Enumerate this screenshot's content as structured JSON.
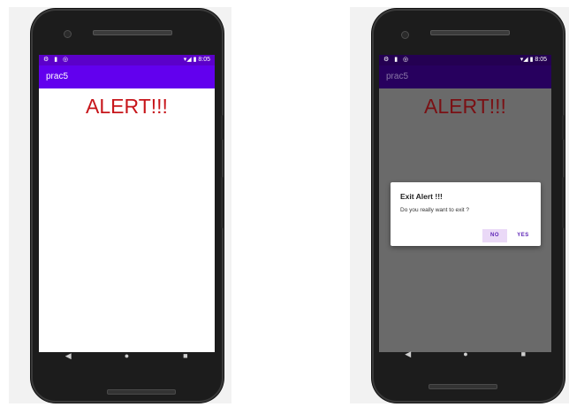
{
  "colors": {
    "status_bar": "#5b00c9",
    "app_bar": "#6200ee",
    "status_bar_dimmed": "#240052",
    "app_bar_dimmed": "#27005e",
    "alert_text": "#c7161b",
    "dialog_button_text": "#5a1fb5",
    "dialog_no_highlight": "#ead9f7"
  },
  "left_phone": {
    "status": {
      "icons": "⚙ ▮ ◎",
      "right": "▾◢ ▮ 8:05"
    },
    "app_title": "prac5",
    "heading": "ALERT!!!",
    "nav": {
      "back": "◀",
      "home": "●",
      "recents": "■"
    }
  },
  "right_phone": {
    "status": {
      "icons": "⚙ ▮ ◎",
      "right": "▾◢ ▮ 8:05"
    },
    "app_title": "prac5",
    "heading": "ALERT!!!",
    "dialog": {
      "title": "Exit Alert !!!",
      "message": "Do you really want to exit ?",
      "negative": "NO",
      "positive": "YES"
    },
    "nav": {
      "back": "◀",
      "home": "●",
      "recents": "■"
    }
  }
}
